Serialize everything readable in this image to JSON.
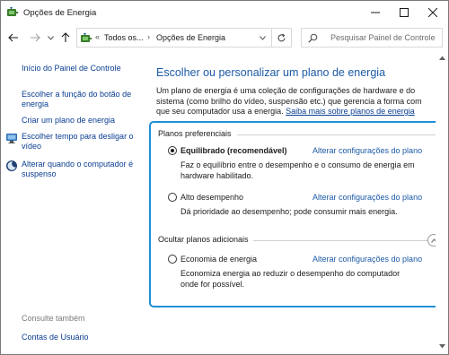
{
  "window": {
    "title": "Opções de Energia",
    "app_icon": "power-options-icon"
  },
  "address_bar": {
    "crumb_separator": "«",
    "crumbs": [
      "Todos os...",
      "Opções de Energia"
    ],
    "arrow": "›",
    "search_placeholder": "Pesquisar Painel de Controle"
  },
  "sidebar": {
    "items": [
      {
        "label": "Início do Painel de Controle"
      },
      {
        "label": "Escolher a função do botão de energia"
      },
      {
        "label": "Criar um plano de energia"
      },
      {
        "label": "Escolher tempo para desligar o vídeo",
        "icon": "monitor-icon"
      },
      {
        "label": "Alterar quando o computador é suspenso",
        "icon": "moon-icon"
      }
    ],
    "see_also": "Consulte também",
    "user_accounts": "Contas de Usuário"
  },
  "main": {
    "title": "Escolher ou personalizar um plano de energia",
    "description": "Um plano de energia é uma coleção de configurações de hardware e do sistema (como brilho do vídeo, suspensão etc.) que gerencia a forma com que seu computador usa a energia.",
    "learn_more": "Saiba mais sobre planos de energia",
    "preferred_label": "Planos preferenciais",
    "hidden_label": "Ocultar planos adicionais",
    "change_link": "Alterar configurações do plano",
    "plans": [
      {
        "name": "Equilibrado (recomendável)",
        "selected": true,
        "description": "Faz o equilíbrio entre o desempenho e o consumo de energia em hardware habilitado."
      },
      {
        "name": "Alto desempenho",
        "selected": false,
        "description": "Dá prioridade ao desempenho; pode consumir mais energia."
      },
      {
        "name": "Economia de energia",
        "selected": false,
        "description": "Economiza energia ao reduzir o desempenho do computador onde for possível."
      }
    ]
  },
  "colors": {
    "accent_border": "#1e8fd6",
    "title_blue": "#1c5aa6",
    "link_blue": "#0a3d91"
  }
}
